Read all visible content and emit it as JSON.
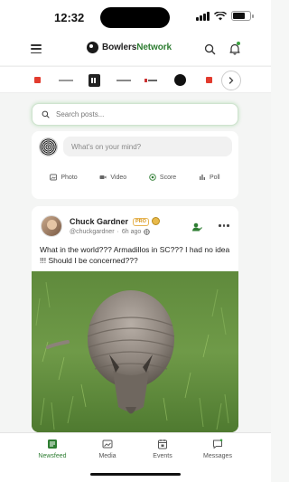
{
  "status_bar": {
    "time": "12:32"
  },
  "header": {
    "brand_part1": "Bowlers",
    "brand_part2": "Network",
    "menu_icon": "menu-icon",
    "search_icon": "search-icon",
    "notifications_icon": "bell-icon"
  },
  "partners": {
    "logos": [
      "red-square-logo",
      "ebonite-style-logo",
      "brand-logo-3",
      "brand-logo-4",
      "brand-logo-5",
      "round-black-logo",
      "red-logo-7"
    ],
    "next_icon": "chevron-right-icon"
  },
  "search": {
    "placeholder": "Search posts..."
  },
  "composer": {
    "placeholder": "What's on your mind?",
    "actions": [
      {
        "label": "Photo",
        "icon": "photo-icon"
      },
      {
        "label": "Video",
        "icon": "video-icon"
      },
      {
        "label": "Score",
        "icon": "score-icon"
      },
      {
        "label": "Poll",
        "icon": "poll-icon"
      }
    ]
  },
  "post": {
    "author_name": "Chuck Gardner",
    "badge": "PRO",
    "handle": "@chuckgardner",
    "time_ago": "6h ago",
    "text": "What in the world???  Armadillos in SC???  I had no idea !!!  Should I be concerned???"
  },
  "bottom_nav": [
    {
      "label": "Newsfeed",
      "icon": "newsfeed-icon",
      "active": true
    },
    {
      "label": "Media",
      "icon": "media-icon",
      "active": false
    },
    {
      "label": "Events",
      "icon": "calendar-icon",
      "active": false
    },
    {
      "label": "Messages",
      "icon": "chat-icon",
      "active": false
    }
  ],
  "colors": {
    "accent": "#2e7d32",
    "pro_badge": "#d9961a",
    "notification_dot": "#3aa23f"
  }
}
